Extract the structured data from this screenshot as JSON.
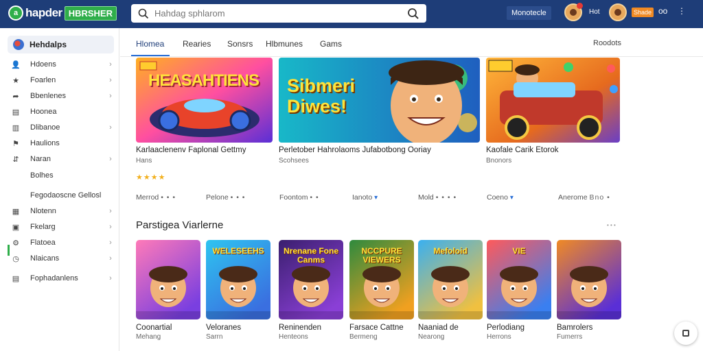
{
  "app": {
    "logo_mark": "a",
    "logo_text": "hapder",
    "logo_badge": "HBRSHER"
  },
  "search": {
    "placeholder": "Hahdag sphlarom"
  },
  "topbar": {
    "chip_label": "Monotecle",
    "label_1": "Hot",
    "orange_label": "Shade",
    "glyph_1": "oo",
    "glyph_2": "⋮"
  },
  "sidebar": {
    "header": "Hehdalps",
    "items": [
      {
        "label": "Hdoens",
        "icon": "person-icon",
        "chevron": true
      },
      {
        "label": "Foarlen",
        "icon": "star-icon",
        "chevron": true
      },
      {
        "label": "Bbenlenes",
        "icon": "share-icon",
        "chevron": true
      },
      {
        "label": "Hoonea",
        "icon": "document-icon",
        "chevron": false
      },
      {
        "label": "Dlibanoe",
        "icon": "bar-chart-icon",
        "chevron": true
      },
      {
        "label": "Haulions",
        "icon": "flag-icon",
        "chevron": false
      },
      {
        "label": "Naran",
        "icon": "trend-icon",
        "chevron": true
      }
    ],
    "sub_label": "Bolhes",
    "group_label": "Fegodaoscne Gellosl",
    "items2": [
      {
        "label": "Nlotenn",
        "icon": "grid-icon",
        "chevron": true
      },
      {
        "label": "Fkelarg",
        "icon": "box-icon",
        "chevron": true
      },
      {
        "label": "Flatoea",
        "icon": "gear-icon",
        "chevron": true
      },
      {
        "label": "Nlaicans",
        "icon": "clock-icon",
        "chevron": true
      }
    ],
    "footer_item": {
      "label": "Fophadanlens",
      "icon": "table-icon",
      "chevron": true
    }
  },
  "tabs": {
    "items": [
      "Hlomea",
      "Rearies",
      "Sonsrs",
      "Hlbmunes",
      "Gams"
    ],
    "active_index": 0,
    "right_label": "Roodots"
  },
  "featured": [
    {
      "art_text": "HEASAHTIENS",
      "title": "Karlaaclenenv Faplonal Gettmy",
      "sub": "Hans",
      "rating": 4
    },
    {
      "art_text": "Sibmeri Diwes!",
      "title": "Perletober Hahrolaoms Jufabotbong Ooriay",
      "sub": "Scohsees"
    },
    {
      "art_text": "",
      "title": "Kaofale Carik Etorok",
      "sub": "Bnonors"
    }
  ],
  "meta_row": [
    {
      "label": "Merrod",
      "dots": "• • •"
    },
    {
      "label": "Pelone",
      "dots": "• • •"
    },
    {
      "label": "Foontom",
      "dots": "• •"
    },
    {
      "label": "Ianoto",
      "chevron": true
    },
    {
      "label": "Mold",
      "dots": "• • • •"
    },
    {
      "label": "Coeno",
      "chevron": true
    },
    {
      "label": "Anerome",
      "dots": "Bno •"
    }
  ],
  "section": {
    "title": "Parstigea Viarlerne",
    "more": "• • •"
  },
  "tiles": [
    {
      "title": "Coonartial",
      "sub": "Mehang",
      "art_text": ""
    },
    {
      "title": "Veloranes",
      "sub": "Sarrn",
      "art_text": "WELESEEHS"
    },
    {
      "title": "Reninenden",
      "sub": "Henteons",
      "art_text": "Nrenane Fone Canms"
    },
    {
      "title": "Farsace Cattne",
      "sub": "Bermeng",
      "art_text": "NCCPURE VIEWERS"
    },
    {
      "title": "Naaniad de",
      "sub": "Nearong",
      "art_text": "Mefoloid"
    },
    {
      "title": "Perlodiang",
      "sub": "Herrons",
      "art_text": "VIE"
    },
    {
      "title": "Bamrolers",
      "sub": "Fumerrs",
      "art_text": ""
    }
  ]
}
